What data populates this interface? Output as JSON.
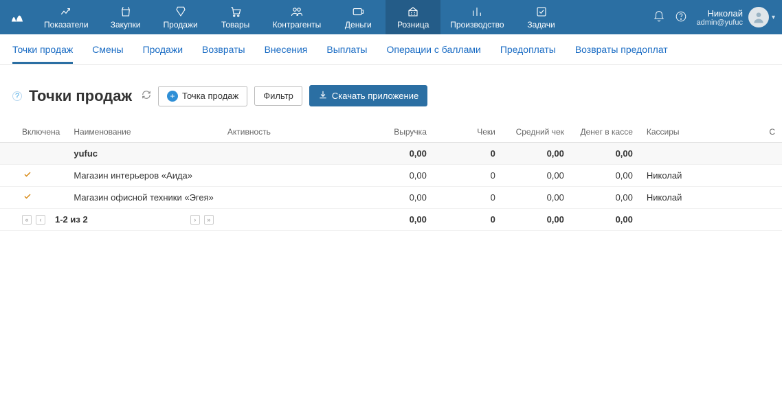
{
  "topnav": {
    "items": [
      {
        "label": "Показатели"
      },
      {
        "label": "Закупки"
      },
      {
        "label": "Продажи"
      },
      {
        "label": "Товары"
      },
      {
        "label": "Контрагенты"
      },
      {
        "label": "Деньги"
      },
      {
        "label": "Розница"
      },
      {
        "label": "Производство"
      },
      {
        "label": "Задачи"
      }
    ],
    "active_index": 6,
    "user": {
      "name": "Николай",
      "sub": "admin@yufuc"
    }
  },
  "subnav": {
    "items": [
      "Точки продаж",
      "Смены",
      "Продажи",
      "Возвраты",
      "Внесения",
      "Выплаты",
      "Операции с баллами",
      "Предоплаты",
      "Возвраты предоплат"
    ],
    "active_index": 0
  },
  "page": {
    "title": "Точки продаж",
    "btn_new": "Точка продаж",
    "btn_filter": "Фильтр",
    "btn_download": "Скачать приложение"
  },
  "table": {
    "headers": {
      "enabled": "Включена",
      "name": "Наименование",
      "activity": "Активность",
      "revenue": "Выручка",
      "checks": "Чеки",
      "avg": "Средний чек",
      "cash": "Денег в кассе",
      "cashiers": "Кассиры",
      "last": "С"
    },
    "group": {
      "name": "yufuc",
      "revenue": "0,00",
      "checks": "0",
      "avg": "0,00",
      "cash": "0,00"
    },
    "rows": [
      {
        "enabled": true,
        "name": "Магазин интерьеров «Аида»",
        "revenue": "0,00",
        "checks": "0",
        "avg": "0,00",
        "cash": "0,00",
        "cashier": "Николай"
      },
      {
        "enabled": true,
        "name": "Магазин офисной техники «Эгея»",
        "revenue": "0,00",
        "checks": "0",
        "avg": "0,00",
        "cash": "0,00",
        "cashier": "Николай"
      }
    ],
    "footer": {
      "pager": "1-2 из 2",
      "revenue": "0,00",
      "checks": "0",
      "avg": "0,00",
      "cash": "0,00"
    }
  }
}
